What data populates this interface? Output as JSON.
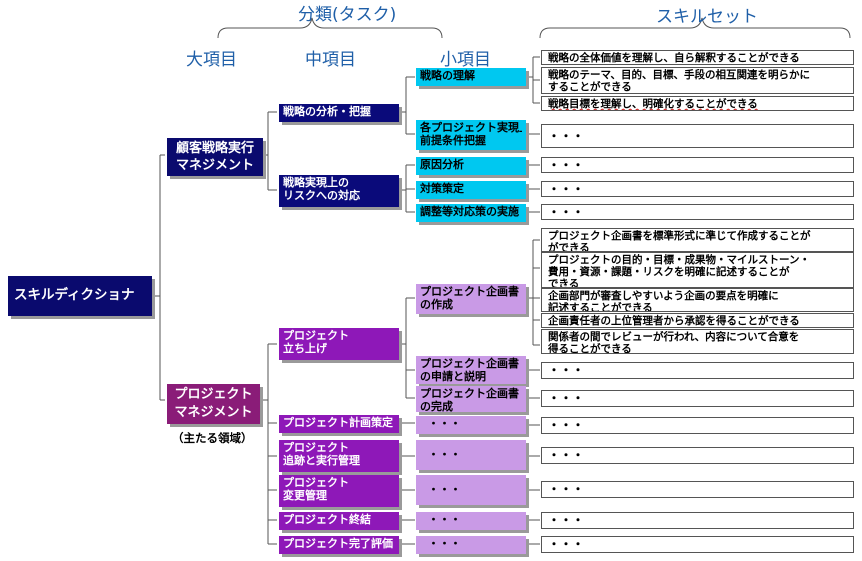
{
  "headers": {
    "bunrui": "分類(タスク)",
    "skillset": "スキルセット",
    "dai": "大項目",
    "chu": "中項目",
    "sho": "小項目"
  },
  "root": "スキルディクショナリ",
  "dai": {
    "kokyaku": [
      "顧客戦略実行",
      "マネジメント"
    ],
    "project": [
      "プロジェクト",
      "マネジメント"
    ],
    "project_note": "（主たる領域）"
  },
  "chu": {
    "bunseki": "戦略の分析・把握",
    "risk": [
      "戦略実現上の",
      "リスクへの対応"
    ],
    "tachiage": [
      "プロジェクト",
      "立ち上げ"
    ],
    "keikaku": "プロジェクト計画策定",
    "tsuiseki": [
      "プロジェクト",
      "追跡と実行管理"
    ],
    "henkou": [
      "プロジェクト",
      "変更管理"
    ],
    "shuketsu": "プロジェクト終結",
    "kanryo": "プロジェクト完了評価"
  },
  "sho": {
    "rikai": "戦略の理解",
    "zentei": [
      "各プロジェクト実現上の",
      "前提条件把握"
    ],
    "genin": "原因分析",
    "taisaku": "対策策定",
    "chousei": "調整等対応策の実施",
    "sakusei": [
      "プロジェクト企画書",
      "の作成"
    ],
    "shinsei": [
      "プロジェクト企画書",
      "の申請と説明"
    ],
    "kansei": [
      "プロジェクト企画書",
      "の完成"
    ],
    "dots": "・・・"
  },
  "skills": {
    "s1": "戦略の全体価値を理解し、自ら解釈することができる",
    "s2": [
      "戦略のテーマ、目的、目標、手段の相互関連を明らかに",
      "することができる"
    ],
    "s3": "戦略目標を理解し、明確化することができる",
    "p1": [
      "プロジェクト企画書を標準形式に準じて作成することが",
      "ができる"
    ],
    "p2": [
      "プロジェクトの目的・目標・成果物・マイルストーン・",
      "費用・資源・課題・リスクを明確に記述することが",
      "できる"
    ],
    "p3": [
      "企画部門が審査しやすいよう企画の要点を明確に",
      "記述することができる"
    ],
    "p4": "企画責任者の上位管理者から承認を得ることができる",
    "p5": [
      "関係者の間でレビューが行われ、内容について合意を",
      "得ることができる"
    ],
    "dots": "・・・"
  }
}
